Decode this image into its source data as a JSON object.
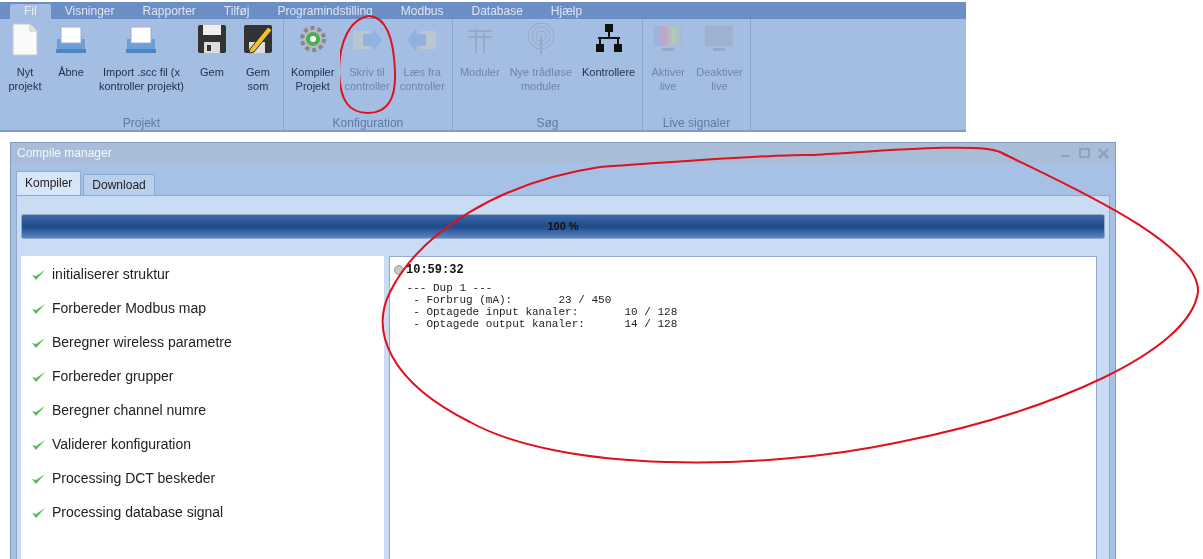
{
  "menu": [
    {
      "label": "Fil",
      "selected": true
    },
    {
      "label": "Visninger",
      "selected": false
    },
    {
      "label": "Rapporter",
      "selected": false
    },
    {
      "label": "Tilføj",
      "selected": false
    },
    {
      "label": "Programindstilling",
      "selected": false
    },
    {
      "label": "Modbus",
      "selected": false
    },
    {
      "label": "Database",
      "selected": false
    },
    {
      "label": "Hjælp",
      "selected": false
    }
  ],
  "ribbon": {
    "groups": [
      {
        "label": "Projekt",
        "buttons": [
          {
            "label": "Nyt\nprojekt",
            "kind": "new",
            "disabled": false
          },
          {
            "label": "Åbne",
            "kind": "open",
            "disabled": false
          },
          {
            "label": "Import .scc fil (x\nkontroller projekt)",
            "kind": "open",
            "disabled": false
          },
          {
            "label": "Gem",
            "kind": "save",
            "disabled": false
          },
          {
            "label": "Gem\nsom",
            "kind": "saveas",
            "disabled": false
          }
        ]
      },
      {
        "label": "Konfiguration",
        "buttons": [
          {
            "label": "Kompiler\nProjekt",
            "kind": "compile",
            "disabled": false
          },
          {
            "label": "Skriv til\ncontroller",
            "kind": "write",
            "disabled": true
          },
          {
            "label": "Læs fra\ncontroller",
            "kind": "read",
            "disabled": true
          }
        ]
      },
      {
        "label": "Søg",
        "buttons": [
          {
            "label": "Moduler",
            "kind": "modules",
            "disabled": true
          },
          {
            "label": "Nye trådløse\nmoduler",
            "kind": "wireless",
            "disabled": true
          },
          {
            "label": "Kontrollere",
            "kind": "network",
            "disabled": false
          }
        ]
      },
      {
        "label": "Live signaler",
        "buttons": [
          {
            "label": "Aktiver\nlive",
            "kind": "monitor-color",
            "disabled": true
          },
          {
            "label": "Deaktiver\nlive",
            "kind": "monitor",
            "disabled": true
          }
        ]
      }
    ]
  },
  "window": {
    "title": "Compile manager",
    "tabs": [
      {
        "label": "Kompiler",
        "selected": true
      },
      {
        "label": "Download",
        "selected": false
      }
    ],
    "progress": {
      "level": 1,
      "label": "100 %"
    },
    "steps": [
      {
        "label": "initialiserer struktur",
        "done": true
      },
      {
        "label": "Forbereder Modbus map",
        "done": true
      },
      {
        "label": "Beregner wireless parametre",
        "done": true
      },
      {
        "label": "Forbereder grupper",
        "done": true
      },
      {
        "label": "Beregner channel numre",
        "done": true
      },
      {
        "label": "Validerer konfiguration",
        "done": true
      },
      {
        "label": "Processing DCT beskeder",
        "done": true
      },
      {
        "label": "Processing database signal",
        "done": true
      }
    ],
    "log": {
      "time": "10:59:32",
      "lines": [
        " --- Dup 1 ---",
        "  - Forbrug (mA):       23 / 450",
        "  - Optagede input kanaler:       10 / 128",
        "  - Optagede output kanaler:      14 / 128"
      ]
    }
  }
}
